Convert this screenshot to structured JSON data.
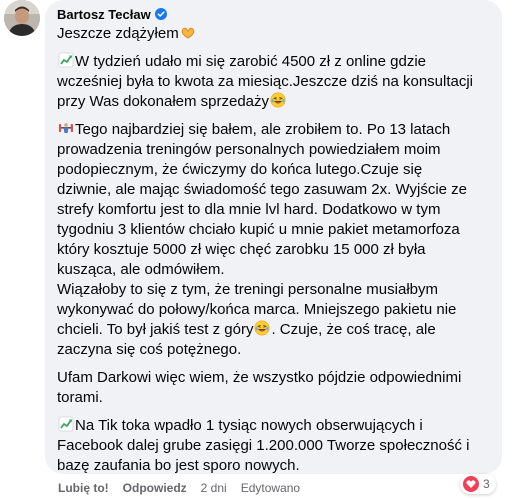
{
  "comment": {
    "author": "Bartosz Tecław",
    "verified": true,
    "paragraphs": [
      {
        "lines": [
          {
            "text": "Jeszcze zdążyłem",
            "emoji_after": "heart-hands-icon"
          }
        ]
      },
      {
        "lines": [
          {
            "emoji_before": "chart-increasing-icon",
            "text": "W tydzień udało mi się zarobić 4500 zł z online gdzie"
          },
          {
            "text": "wcześniej była to kwota za miesiąc.Jeszcze dziś na konsultacji"
          },
          {
            "text": "przy Was dokonałem sprzedaży",
            "emoji_after": "laughing-icon"
          }
        ]
      },
      {
        "lines": [
          {
            "emoji_before": "weight-lifter-icon",
            "text": "Tego najbardziej się bałem, ale zrobiłem to. Po 13 latach"
          },
          {
            "text": "prowadzenia treningów personalnych powiedziałem moim"
          },
          {
            "text": "podopiecznym, że ćwiczymy do końca lutego.Czuje się"
          },
          {
            "text": "dziwnie, ale mając świadomość tego zasuwam 2x. Wyjście ze"
          },
          {
            "text": "strefy komfortu jest to dla mnie lvl hard. Dodatkowo w tym"
          },
          {
            "text": "tygodniu 3 klientów chciało kupić u mnie pakiet metamorfoza"
          },
          {
            "text": "który kosztuje 5000 zł więc chęć zarobku 15 000 zł była"
          },
          {
            "text": "kusząca, ale odmówiłem."
          },
          {
            "text": "Wiązałoby to się z tym, że treningi personalne musiałbym"
          },
          {
            "text": "wykonywać do połowy/końca marca. Mniejszego pakietu nie"
          },
          {
            "text": "chcieli. To był jakiś test z góry",
            "emoji_after": "laughing-icon",
            "text_after": ". Czuje, że coś tracę, ale"
          },
          {
            "text": "zaczyna się coś potężnego."
          }
        ]
      },
      {
        "lines": [
          {
            "text": "Ufam Darkowi więc wiem, że wszystko pójdzie odpowiednimi"
          },
          {
            "text": "torami."
          }
        ]
      },
      {
        "lines": [
          {
            "emoji_before": "chart-increasing-icon",
            "text": "Na Tik toka wpadło 1 tysiąc nowych obserwujących i"
          },
          {
            "text": "Facebook dalej grube zasięgi 1.200.000 Tworze społeczność i"
          },
          {
            "text": "bazę zaufania bo jest sporo nowych."
          }
        ]
      }
    ],
    "actions": {
      "like": "Lubię to!",
      "reply": "Odpowiedz",
      "time": "2 dni",
      "edited": "Edytowano"
    },
    "reactions": {
      "icon": "heart-icon",
      "count": "3"
    }
  }
}
